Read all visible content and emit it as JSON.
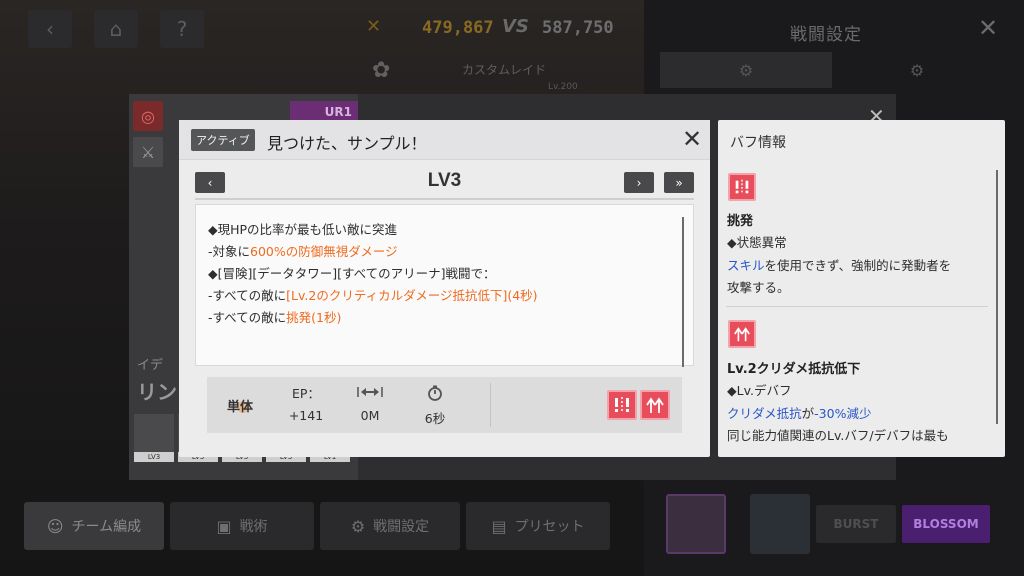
{
  "background": {
    "score_left": "479,867",
    "vs_label": "VS",
    "score_right": "587,750",
    "battle_settings_title": "戦闘設定",
    "custom_raid_label": "カスタムレイド",
    "custom_raid_sub": "Lv.200",
    "character_name_small": "イデ",
    "character_name_large": "リン",
    "ur_badge": "UR1",
    "skill_slot_levels": [
      "LV3",
      "LV3",
      "LV3",
      "LV3",
      "LV1"
    ],
    "bottom_buttons": {
      "team_edit": "チーム編成",
      "tactics": "戦術",
      "battle_settings": "戦闘設定",
      "preset": "プリセット"
    },
    "mode_buttons": {
      "burst": "BURST",
      "blossom": "BLOSSOM"
    }
  },
  "skill_popup": {
    "tag": "アクティブ",
    "title": "見つけた、サンプル！",
    "level_label": "LV3",
    "description": {
      "line1": "◆現HPの比率が最も低い敵に突進",
      "line2_prefix": "-対象に",
      "line2_highlight": "600%の防御無視ダメージ",
      "line3": "◆[冒険][データタワー][すべてのアリーナ]戦闘で：",
      "line4_prefix": "-すべての敵に",
      "line4_highlight": "[Lv.2のクリティカルダメージ抵抗低下](4秒)",
      "line5_prefix": "-すべての敵に",
      "line5_highlight": "挑発(1秒)"
    },
    "stats": {
      "target": "単体",
      "ep_label": "EP：",
      "ep_value": "+141",
      "range_value": "0M",
      "cooldown_value": "6秒"
    }
  },
  "buff_panel": {
    "title": "バフ情報",
    "buffs": [
      {
        "name": "挑発",
        "type": "◆状態異常",
        "desc1_highlight": "スキル",
        "desc1_rest": "を使用できず、強制的に発動者を",
        "desc2": "攻撃する。"
      },
      {
        "name": "Lv.2クリダメ抵抗低下",
        "type": "◆Lv.デバフ",
        "desc1_highlight": "クリダメ抵抗",
        "desc1_mid": "が",
        "desc1_highlight2": "-30%減少",
        "desc2": "同じ能力値関連のLv.バフ/デバフは最も"
      }
    ]
  },
  "colors": {
    "highlight_orange": "#ef6b1f",
    "highlight_blue": "#2856c8",
    "debuff_red": "#e84d5c",
    "score_left": "#c9972e",
    "score_right": "#9a9a9a",
    "blossom": "#7b2fbf"
  }
}
